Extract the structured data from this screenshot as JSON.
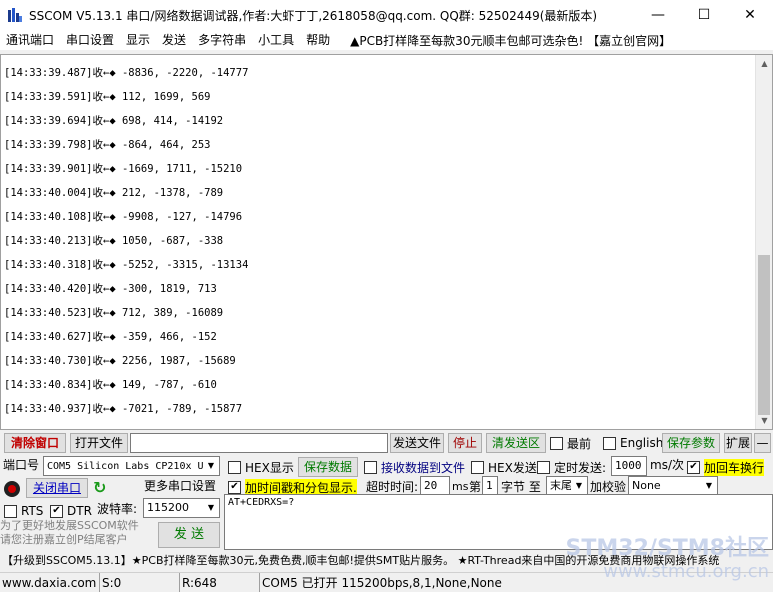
{
  "window": {
    "title": "SSCOM V5.13.1 串口/网络数据调试器,作者:大虾丁丁,2618058@qq.com. QQ群: 52502449(最新版本)",
    "minimize": "—",
    "maximize": "☐",
    "close": "✕"
  },
  "menu": {
    "items": [
      "通讯端口",
      "串口设置",
      "显示",
      "发送",
      "多字符串",
      "小工具",
      "帮助"
    ],
    "ad": "▲PCB打样降至每款30元顺丰包邮可选杂色! 【嘉立创官网】"
  },
  "log": {
    "lines": [
      "[14:33:39.487]收←◆ -8836, -2220, -14777",
      "[14:33:39.591]收←◆ 112, 1699, 569",
      "[14:33:39.694]收←◆ 698, 414, -14192",
      "[14:33:39.798]收←◆ -864, 464, 253",
      "[14:33:39.901]收←◆ -1669, 1711, -15210",
      "[14:33:40.004]收←◆ 212, -1378, -789",
      "[14:33:40.108]收←◆ -9908, -127, -14796",
      "[14:33:40.213]收←◆ 1050, -687, -338",
      "[14:33:40.318]收←◆ -5252, -3315, -13134",
      "[14:33:40.420]收←◆ -300, 1819, 713",
      "[14:33:40.523]收←◆ 712, 389, -16089",
      "[14:33:40.627]收←◆ -359, 466, -152",
      "[14:33:40.730]收←◆ 2256, 1987, -15689",
      "[14:33:40.834]收←◆ 149, -787, -610",
      "[14:33:40.937]收←◆ -7021, -789, -15877"
    ]
  },
  "toolbar": {
    "clear_window": "清除窗口",
    "open_file": "打开文件",
    "file_path": "",
    "send_file": "发送文件",
    "stop": "停止",
    "clear_send": "清发送区",
    "topmost": "最前",
    "english": "English",
    "save_params": "保存参数",
    "expand": "扩展",
    "collapse": "—"
  },
  "port": {
    "label": "端口号",
    "value": "COM5 Silicon Labs CP210x U",
    "hex_display": "HEX显示",
    "save_data": "保存数据",
    "recv_to_file": "接收数据到文件",
    "hex_send": "HEX发送",
    "timed_send": "定时发送:",
    "interval": "1000",
    "interval_unit": "ms/次",
    "add_crlf": "加回车换行"
  },
  "row3": {
    "close_port": "关闭串口",
    "more_settings": "更多串口设置",
    "timestamp_label": "加时间戳和分包显示.",
    "timeout_label": "超时时间:",
    "timeout_value": "20",
    "timeout_unit": "ms",
    "nth_label": "第",
    "nth_value": "1",
    "byte_label": "字节 至",
    "end_value": "末尾",
    "checksum_label": "加校验",
    "checksum_value": "None"
  },
  "row4": {
    "rts": "RTS",
    "dtr": "DTR",
    "baud_label": "波特率:",
    "baud_value": "115200"
  },
  "send": {
    "text": "AT+CEDRXS=?",
    "button": "发 送",
    "hint_line1": "为了更好地发展SSCOM软件",
    "hint_line2": "请您注册嘉立创P结尾客户"
  },
  "promo": "【升级到SSCOM5.13.1】★PCB打样降至每款30元,免费色费,顺丰包邮!提供SMT贴片服务。 ★RT-Thread来自中国的开源免费商用物联网操作系统",
  "status": {
    "website": "www.daxia.com",
    "sent": "S:0",
    "received": "R:648",
    "port_state": "COM5 已打开  115200bps,8,1,None,None"
  },
  "watermark": {
    "line1": "STM32/STM8社区",
    "line2": "www.stmcu.org.cn"
  },
  "colors": {
    "highlight": "#ffff00",
    "clear_btn_text": "#c00000",
    "green_text": "#007a00"
  }
}
